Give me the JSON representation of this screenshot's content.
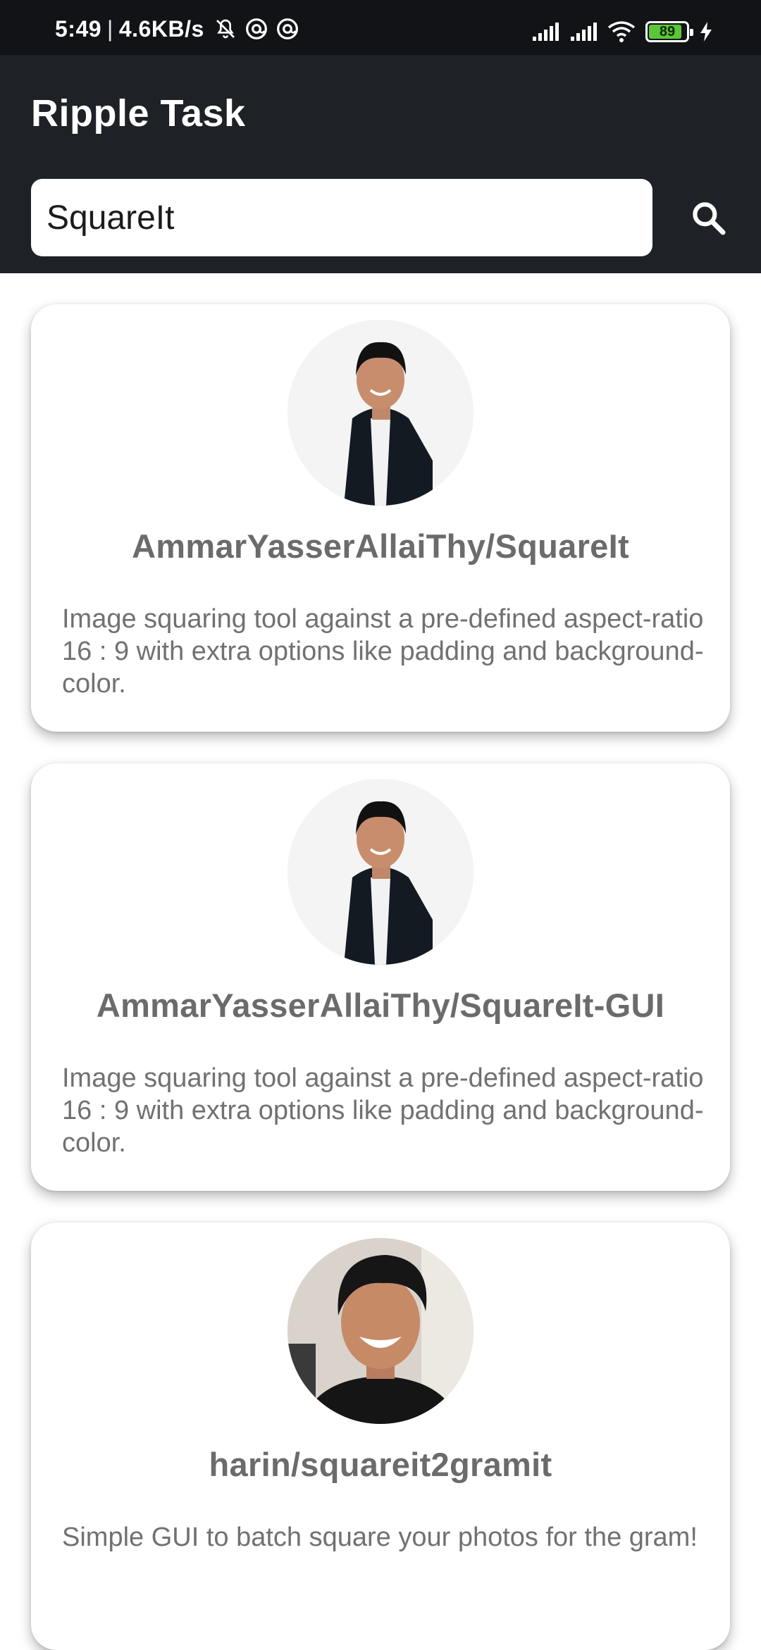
{
  "status_bar": {
    "time": "5:49",
    "separator": "|",
    "network_speed": "4.6KB/s",
    "left_icons": [
      "bell-off-icon",
      "at-sign-icon",
      "at-sign-icon"
    ],
    "right_icons": [
      "signal-icon",
      "signal-icon",
      "wifi-icon"
    ],
    "battery_level": "89",
    "battery_fraction": 0.89,
    "charging_icon": "bolt-icon"
  },
  "app_bar": {
    "title": "Ripple Task",
    "background": "#1e2126"
  },
  "search": {
    "value": "SquareIt",
    "icon": "search-icon"
  },
  "repositories": [
    {
      "name": "AmmarYasserAllaiThy/SquareIt",
      "description": "Image squaring tool against a pre-defined aspect-ratio 16 : 9 with extra options like padding and background-color."
    },
    {
      "name": "AmmarYasserAllaiThy/SquareIt-GUI",
      "description": "Image squaring tool against a pre-defined aspect-ratio 16 : 9 with extra options like padding and background-color."
    },
    {
      "name": "harin/squareit2gramit",
      "description": "Simple GUI to batch square your photos for the gram!"
    }
  ],
  "colors": {
    "status_bar": "#121316",
    "title_text": "#6b6b6b",
    "desc_text": "#717171",
    "battery_green": "#5cc639"
  }
}
